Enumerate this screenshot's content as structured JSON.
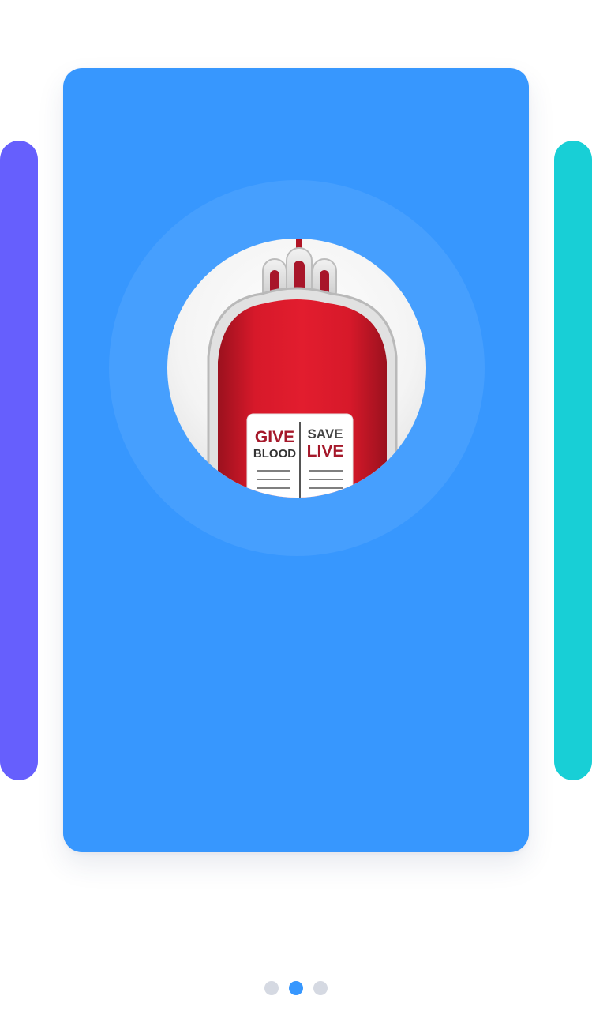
{
  "carousel": {
    "cards": [
      {
        "position": "previous",
        "color": "#665ffd"
      },
      {
        "position": "current",
        "color": "#3797fe"
      },
      {
        "position": "next",
        "color": "#18cfd6"
      }
    ],
    "illustration": {
      "icon": "blood-bag-icon",
      "label_left_top": "GIVE",
      "label_left_bottom": "BLOOD",
      "label_right_top": "SAVE",
      "label_right_bottom": "LIVE"
    },
    "pagination": {
      "total": 3,
      "active_index": 1
    }
  },
  "colors": {
    "blood_red": "#d7192a",
    "label_red": "#a5182a",
    "dot_inactive": "#d5d9e2",
    "dot_active": "#3797fe"
  }
}
